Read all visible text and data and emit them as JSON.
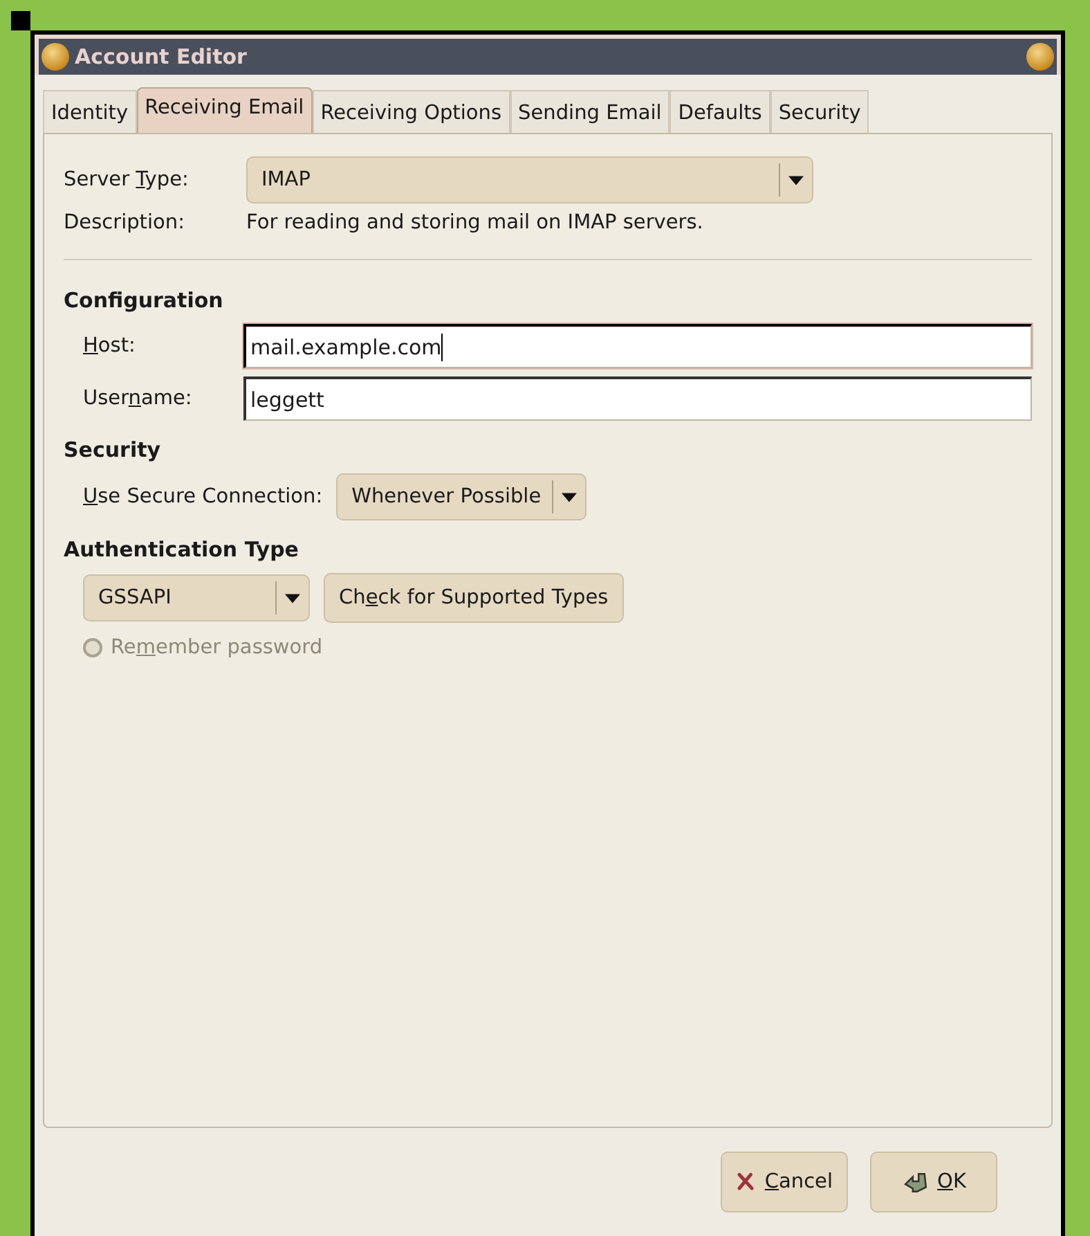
{
  "window": {
    "title": "Account Editor"
  },
  "tabs": [
    {
      "label": "Identity",
      "selected": false
    },
    {
      "label": "Receiving Email",
      "selected": true
    },
    {
      "label": "Receiving Options",
      "selected": false
    },
    {
      "label": "Sending Email",
      "selected": false
    },
    {
      "label": "Defaults",
      "selected": false
    },
    {
      "label": "Security",
      "selected": false
    }
  ],
  "server_type": {
    "label": {
      "before": "Server ",
      "key": "T",
      "after": "ype:"
    },
    "value": "IMAP"
  },
  "description": {
    "label": "Description:",
    "text": "For reading and storing mail on IMAP servers."
  },
  "configuration": {
    "heading": "Configuration",
    "fields": [
      {
        "label": {
          "key": "H",
          "after": "ost:"
        },
        "value": "mail.example.com",
        "focused": true
      },
      {
        "label": {
          "before": "User",
          "key": "n",
          "after": "ame:"
        },
        "value": "leggett",
        "focused": false
      }
    ]
  },
  "security": {
    "heading": "Security",
    "label": {
      "key": "U",
      "after": "se Secure Connection:"
    },
    "value": "Whenever Possible"
  },
  "authentication": {
    "heading": "Authentication Type",
    "value": "GSSAPI",
    "check_button": {
      "before": "Ch",
      "key": "e",
      "after": "ck for Supported Types"
    },
    "remember_password": {
      "label": {
        "before": "Re",
        "key": "m",
        "after": "ember password"
      },
      "checked": false,
      "disabled": true
    }
  },
  "buttons": [
    {
      "kind": "cancel",
      "label": {
        "key": "C",
        "after": "ancel"
      }
    },
    {
      "kind": "ok",
      "label": {
        "key": "O",
        "after": "K"
      }
    }
  ]
}
